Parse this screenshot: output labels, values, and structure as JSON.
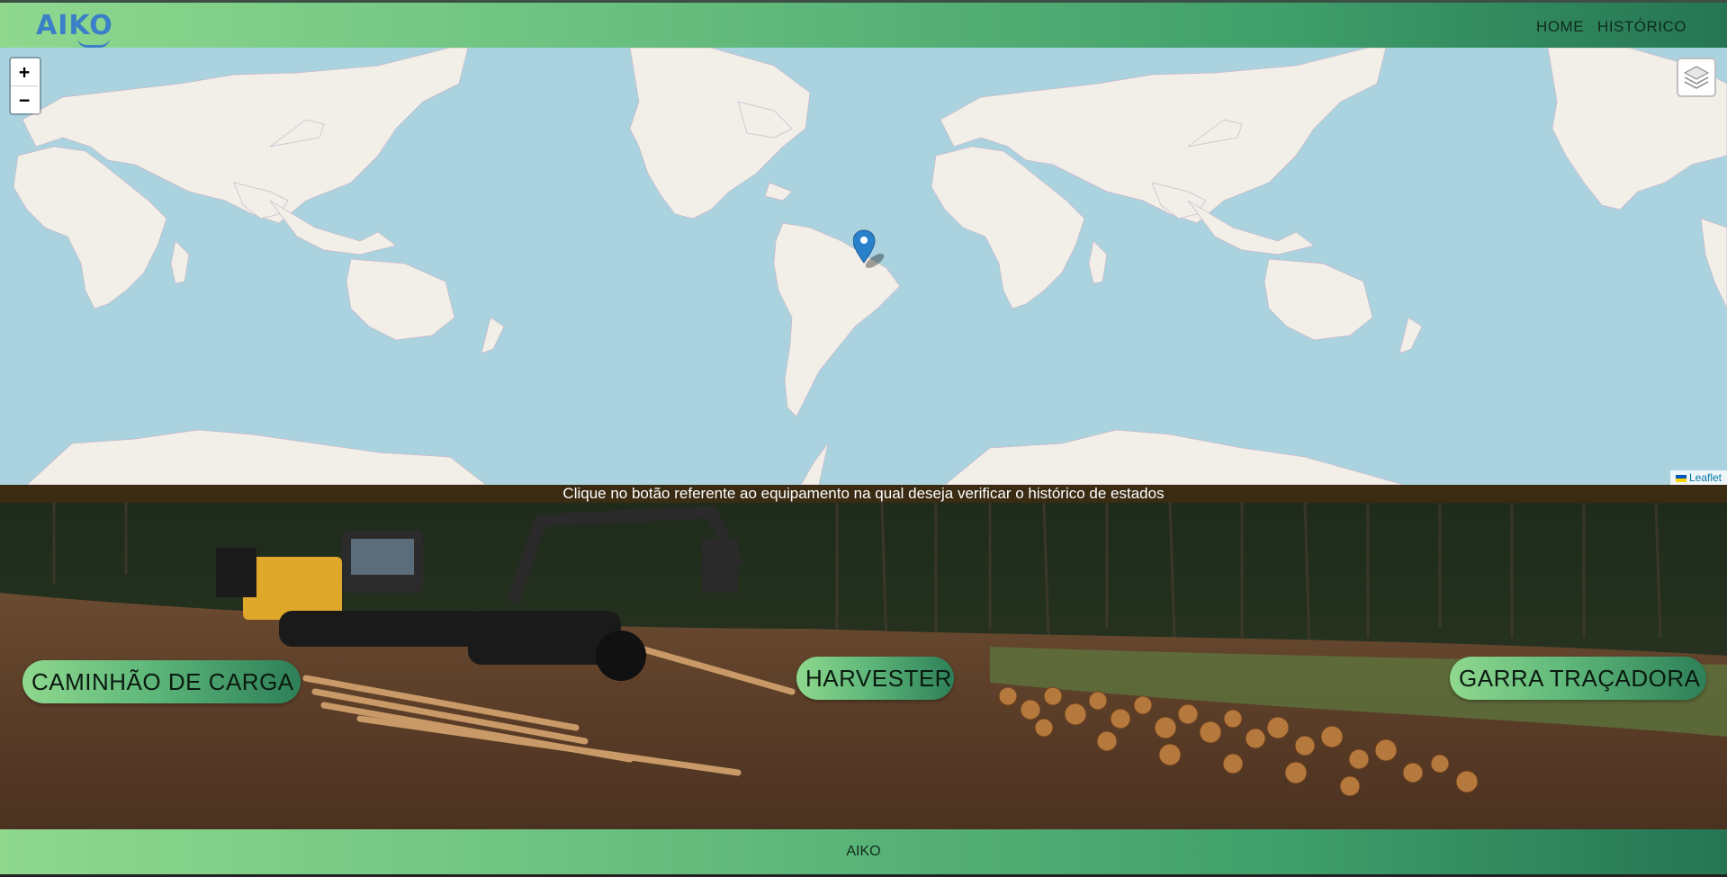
{
  "header": {
    "logo": "AIKO",
    "nav": [
      {
        "label": "HOME"
      },
      {
        "label": "HISTÓRICO"
      }
    ]
  },
  "map": {
    "zoom_in": "+",
    "zoom_out": "−",
    "layers_icon": "layers-icon",
    "attribution": "Leaflet",
    "marker_icon": "map-pin-icon",
    "colors": {
      "water": "#aad3df",
      "land": "#f2efe9",
      "marker": "#2a81cb"
    }
  },
  "caption": "Clique no botão referente ao equipamento na qual deseja verificar o histórico de estados",
  "equipment_buttons": [
    {
      "label": "CAMINHÃO DE CARGA"
    },
    {
      "label": "HARVESTER"
    },
    {
      "label": "GARRA TRAÇADORA"
    }
  ],
  "footer": {
    "text": "AIKO"
  },
  "colors": {
    "header_gradient_start": "#8fd88e",
    "header_gradient_end": "#257553",
    "logo": "#3b7fc8",
    "caption_bg": "#3a2b12"
  }
}
